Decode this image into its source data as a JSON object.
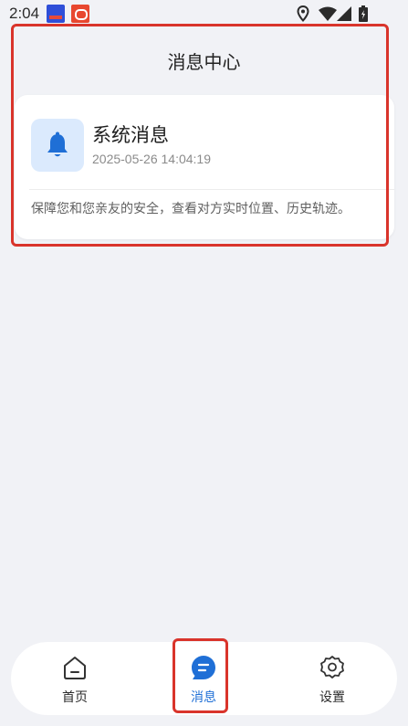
{
  "status_bar": {
    "time": "2:04",
    "icons": [
      "app-notification-icon",
      "app-notification-icon",
      "location-icon",
      "wifi-icon",
      "signal-icon",
      "battery-icon"
    ]
  },
  "header": {
    "title": "消息中心"
  },
  "message": {
    "icon": "bell-icon",
    "title": "系统消息",
    "timestamp": "2025-05-26 14:04:19",
    "body": "保障您和您亲友的安全，查看对方实时位置、历史轨迹。"
  },
  "bottom_nav": {
    "items": [
      {
        "label": "首页",
        "icon": "home-icon",
        "active": false
      },
      {
        "label": "消息",
        "icon": "message-icon",
        "active": true
      },
      {
        "label": "设置",
        "icon": "gear-icon",
        "active": false
      }
    ]
  },
  "colors": {
    "background": "#f1f2f6",
    "accent": "#1f6fd6",
    "highlight": "#d9342b",
    "icon_bg": "#dbeafd"
  }
}
